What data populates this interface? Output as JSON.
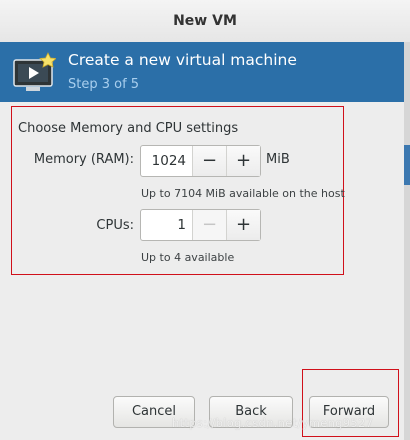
{
  "window": {
    "title": "New VM"
  },
  "banner": {
    "title": "Create a new virtual machine",
    "step": "Step 3 of 5",
    "icon": "vm-monitor-icon"
  },
  "settings": {
    "heading": "Choose Memory and CPU settings",
    "memory": {
      "label": "Memory (RAM):",
      "value": "1024",
      "unit": "MiB",
      "hint": "Up to 7104 MiB available on the host",
      "decrement": "−",
      "increment": "+"
    },
    "cpus": {
      "label": "CPUs:",
      "value": "1",
      "hint": "Up to 4 available",
      "decrement": "−",
      "increment": "+"
    }
  },
  "buttons": {
    "cancel": "Cancel",
    "back": "Back",
    "forward": "Forward"
  },
  "watermark": "https://blog.csdn.net/ymeng9527",
  "colors": {
    "banner": "#2b6fa8",
    "step_text": "#a9cfee",
    "annotation": "#d0101a"
  }
}
